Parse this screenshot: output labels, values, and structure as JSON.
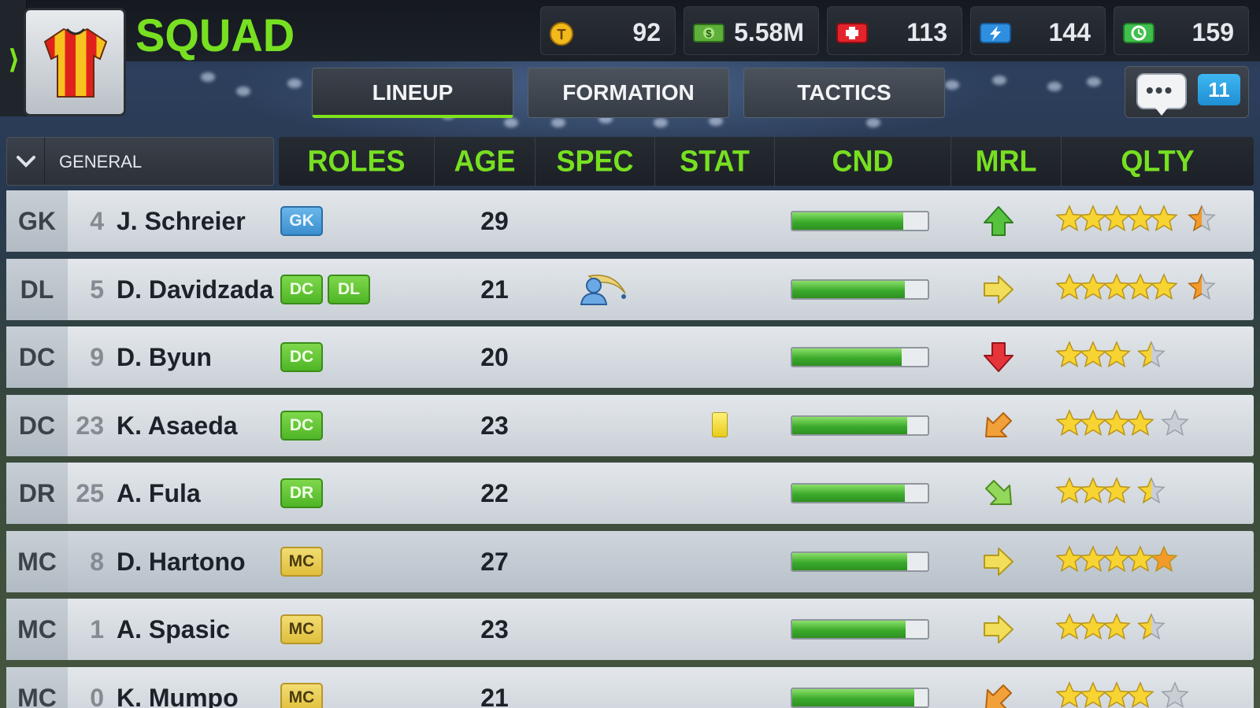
{
  "header": {
    "title": "SQUAD",
    "resources": [
      {
        "icon": "token-coin-icon",
        "value": "92"
      },
      {
        "icon": "cash-icon",
        "value": "5.58M"
      },
      {
        "icon": "medical-kit-icon",
        "value": "113"
      },
      {
        "icon": "energy-icon",
        "value": "144"
      },
      {
        "icon": "time-boost-icon",
        "value": "159"
      }
    ]
  },
  "tabs": [
    {
      "label": "LINEUP",
      "active": true
    },
    {
      "label": "FORMATION",
      "active": false
    },
    {
      "label": "TACTICS",
      "active": false
    }
  ],
  "chat": {
    "count": "11",
    "icon": "chat-bubble-icon"
  },
  "filter": {
    "label": "GENERAL"
  },
  "columns": [
    "ROLES",
    "AGE",
    "SPEC",
    "STAT",
    "CND",
    "MRL",
    "QLTY"
  ],
  "colors": {
    "accent": "#77e021",
    "gk_badge": "#4a9fdc",
    "def_badge": "#5cc32f",
    "mid_badge": "#e8c94a"
  },
  "players": [
    {
      "pos": "GK",
      "num": "4",
      "name": "J. Schreier",
      "roles": [
        {
          "label": "GK",
          "type": "gk"
        }
      ],
      "age": "29",
      "spec": "",
      "stat": "",
      "condition": 0.82,
      "morale": "up",
      "quality": 5.5
    },
    {
      "pos": "DL",
      "num": "5",
      "name": "D. Davidzada",
      "roles": [
        {
          "label": "DC",
          "type": "def"
        },
        {
          "label": "DL",
          "type": "def"
        }
      ],
      "age": "21",
      "spec": "specialist-icon",
      "stat": "",
      "condition": 0.83,
      "morale": "right",
      "quality": 5.5
    },
    {
      "pos": "DC",
      "num": "9",
      "name": "D. Byun",
      "roles": [
        {
          "label": "DC",
          "type": "def"
        }
      ],
      "age": "20",
      "spec": "",
      "stat": "",
      "condition": 0.81,
      "morale": "down",
      "quality": 3.5
    },
    {
      "pos": "DC",
      "num": "23",
      "name": "K. Asaeda",
      "roles": [
        {
          "label": "DC",
          "type": "def"
        }
      ],
      "age": "23",
      "spec": "",
      "stat": "yellow-card-icon",
      "condition": 0.85,
      "morale": "down-left",
      "quality": 4
    },
    {
      "pos": "DR",
      "num": "25",
      "name": "A. Fula",
      "roles": [
        {
          "label": "DR",
          "type": "def"
        }
      ],
      "age": "22",
      "spec": "",
      "stat": "",
      "condition": 0.83,
      "morale": "down-right",
      "quality": 3.5
    },
    {
      "pos": "MC",
      "num": "8",
      "name": "D. Hartono",
      "roles": [
        {
          "label": "MC",
          "type": "mid"
        }
      ],
      "age": "27",
      "spec": "",
      "stat": "",
      "condition": 0.85,
      "morale": "right",
      "quality": 5
    },
    {
      "pos": "MC",
      "num": "1",
      "name": "A. Spasic",
      "roles": [
        {
          "label": "MC",
          "type": "mid"
        }
      ],
      "age": "23",
      "spec": "",
      "stat": "",
      "condition": 0.84,
      "morale": "right",
      "quality": 3.5
    },
    {
      "pos": "MC",
      "num": "0",
      "name": "K. Mumpo",
      "roles": [
        {
          "label": "MC",
          "type": "mid"
        }
      ],
      "age": "21",
      "spec": "",
      "stat": "",
      "condition": 0.9,
      "morale": "down-left",
      "quality": 4
    }
  ]
}
